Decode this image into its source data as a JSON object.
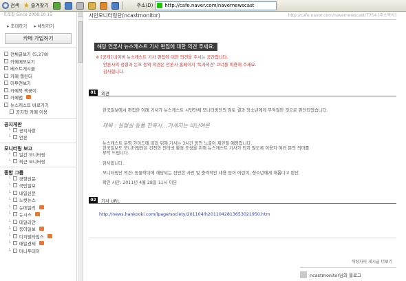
{
  "toolbar": {
    "search_label": "검색",
    "favorites_label": "즐겨찾기",
    "address_label": "주소(D)",
    "address_url": "http://cafe.naver.com/navernewscast"
  },
  "sidebar": {
    "since": "프로필  Since 2008.10.15",
    "invite_label": "초대하기",
    "chat_label": "채팅하기",
    "join_button": "카페 가입하기",
    "menu": [
      {
        "label": "전체글보기 (5,278)",
        "indent": false
      },
      {
        "label": "카페메모보기",
        "indent": false
      },
      {
        "label": "베스트게시물",
        "indent": false
      },
      {
        "label": "카페 캘린더",
        "indent": false
      },
      {
        "label": "미투앤보기",
        "indent": false
      },
      {
        "label": "카페북 책꽂이",
        "indent": false
      },
      {
        "label": "카페앱",
        "indent": false,
        "badge": true
      },
      {
        "label": "뉴스캐스트 바로가기",
        "indent": false
      },
      {
        "label": "공지형 카페 이용",
        "indent": true
      }
    ],
    "sections": [
      {
        "title": "공지게판",
        "items": [
          {
            "label": "공지사항",
            "badge": false
          },
          {
            "label": "언론",
            "badge": false
          }
        ]
      },
      {
        "title": "모니터링 보고",
        "items": [
          {
            "label": "일간 모니터링",
            "badge": false
          },
          {
            "label": "최근 모니터링",
            "badge": false
          }
        ]
      },
      {
        "title": "종합 그룹",
        "items": [
          {
            "label": "경향신문",
            "badge": false
          },
          {
            "label": "국민일보",
            "badge": false
          },
          {
            "label": "내일신문",
            "badge": false
          },
          {
            "label": "노컷뉴스",
            "badge": false
          },
          {
            "label": "뉴데일리",
            "badge": true
          },
          {
            "label": "뉴시스",
            "badge": true
          },
          {
            "label": "데일리안",
            "badge": false
          },
          {
            "label": "동아일보",
            "badge": true
          },
          {
            "label": "디지털타임스",
            "badge": true
          },
          {
            "label": "매일경제",
            "badge": true
          },
          {
            "label": "머니투데이",
            "badge": false
          }
        ]
      }
    ]
  },
  "main": {
    "board_title": "시민모니터링단(ncastmonitor)",
    "post_url": "http://cafe.naver.com/navernewscast/7754  [주소복사]",
    "headline": "해당 언론사 뉴스캐스트 기사 편집에 대한 의견 주세요.",
    "notice": [
      "※ [공개] 네이버 뉴스캐스트 기사 편집에 대한 의견을 주시는 공간입니다.",
      "언론사의 성향과 논조 등의 의견은 언론사 홈페이지 '독자의견' 코너를 이용해 주세요.",
      "감사합니다."
    ],
    "section1": {
      "num": "01",
      "label": "의견"
    },
    "body1": "한국일보에서 편집한 이래 기사가 뉴스캐스트 시민단체 모니터링단의 검토 결과 청소년에게 부적절한 것으로 판단되었습니다.",
    "subtitle": "제목 : 실험실 동물 잔혹사…거세지는 비난여론",
    "body2": [
      "뉴스캐스트 운영 가이드에 따라 위해 기사는 3시간 동안 노출이 제한될 예정입니다.",
      "한국일보도 모니터링단은 건전한 인터넷 환경 조성을 위해 뉴스캐스트 기사가 되지 않도록 이용자 여러 분의 의미를",
      "부탁 드립니다."
    ],
    "thanks": "감사합니다.",
    "body3": "모니터링단 의견: 동물학대에 해당되는 잔인한 사진 및 충격적인 내용 등이 어린이, 청소년에게 해롭다고 판단",
    "time": "확인 시간: 2011년 4월 28일 11시 이분",
    "section2": {
      "num": "02",
      "label": "기사 URL"
    },
    "url": "http://news.hankooki.com/lpage/society/201104/h2011042813653021950.htm",
    "author_note": "작성자의 게시글 더보기",
    "author": "ncastmonitor님의 블로그"
  }
}
